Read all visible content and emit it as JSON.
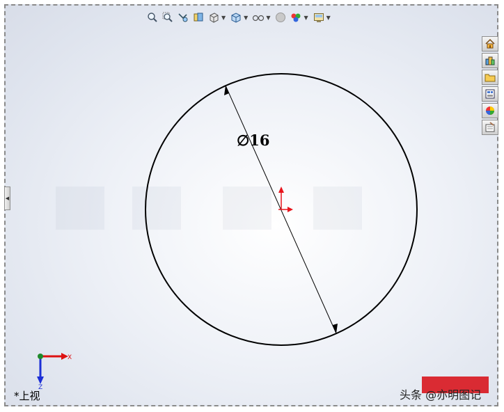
{
  "view": {
    "orientation_label": "*上视",
    "dimension_label": "∅16",
    "credit_text": "头条 @亦明图记"
  },
  "toolbar": {
    "items": [
      {
        "icon": "zoom-to-fit-icon"
      },
      {
        "icon": "zoom-to-area-icon"
      },
      {
        "icon": "previous-view-icon"
      },
      {
        "icon": "section-view-icon"
      },
      {
        "icon": "view-orientation-icon"
      },
      {
        "icon": "display-style-icon"
      },
      {
        "icon": "hide-show-items-icon"
      },
      {
        "icon": "edit-appearance-icon"
      },
      {
        "icon": "apply-scene-icon"
      },
      {
        "icon": "view-settings-icon"
      }
    ]
  },
  "task_pane": {
    "items": [
      {
        "icon": "home-icon"
      },
      {
        "icon": "design-library-icon"
      },
      {
        "icon": "file-explorer-icon"
      },
      {
        "icon": "view-palette-icon"
      },
      {
        "icon": "appearances-icon"
      },
      {
        "icon": "custom-properties-icon"
      }
    ]
  },
  "triad": {
    "x_label": "X",
    "z_label": "Z"
  },
  "colors": {
    "accent_red": "#e8141c",
    "axis_blue": "#1c2fd6",
    "stamp_red": "#d8161e"
  }
}
